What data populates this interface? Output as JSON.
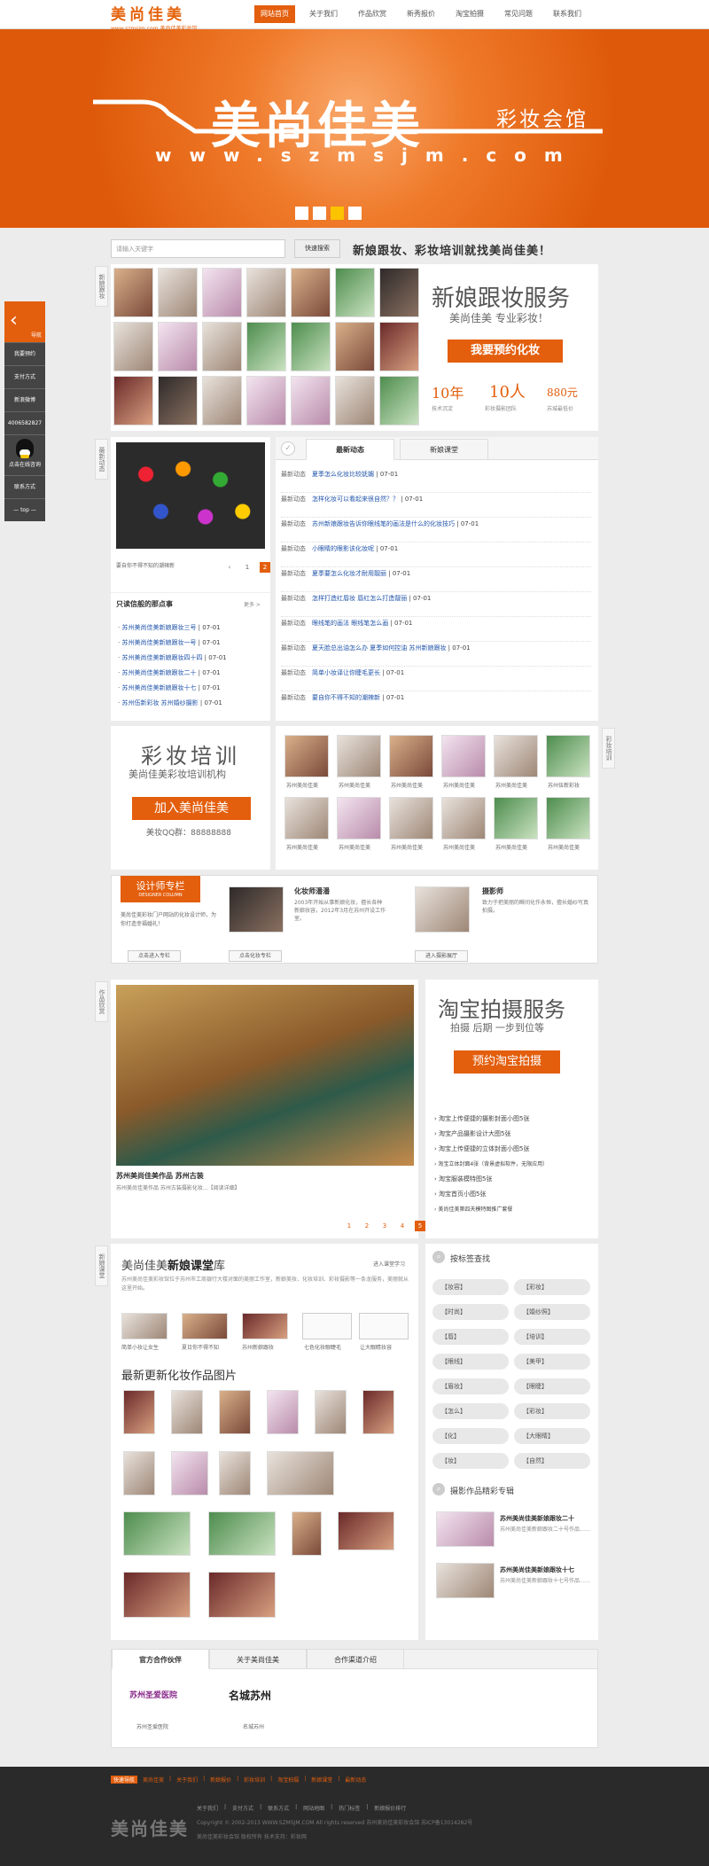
{
  "brand": {
    "name": "美尚佳美",
    "sub": "www.szmsjm.com 美尚佳美彩妆馆"
  },
  "nav": [
    "网站首页",
    "关于我们",
    "作品欣赏",
    "新秀报价",
    "淘宝拍摄",
    "常见问题",
    "联系我们"
  ],
  "banner": {
    "title": "美尚佳美",
    "subtitle": "彩妆会馆",
    "url": "www.szmsjm.com"
  },
  "search": {
    "placeholder": "请输入关键字",
    "button": "快速搜索",
    "slogan": "新娘跟妆、彩妆培训就找美尚佳美！"
  },
  "sidebar": {
    "top": "导航",
    "items": [
      "我要预约",
      "支付方式",
      "新浪微博",
      "4006582827",
      "点击在线咨询",
      "联系方式",
      "— top —"
    ]
  },
  "bride": {
    "tag": "新娘跟妆",
    "title": "新娘跟妆服务",
    "subtitle": "美尚佳美 专业彩妆！",
    "button": "我要预约化妆",
    "stats": [
      {
        "num": "10年",
        "label": "技术沉淀"
      },
      {
        "num": "10人",
        "label": "彩妆摄影团队"
      },
      {
        "num": "880元",
        "label": "苏城最低价"
      }
    ]
  },
  "news": {
    "tag": "最新动态",
    "caption": "要自你不得不知的潮辣新",
    "tabs": [
      "最新动态",
      "新娘课堂"
    ],
    "items": [
      {
        "k": "最新动态",
        "t": "夏季怎么化妆比较妩媚",
        "d": "07-01"
      },
      {
        "k": "最新动态",
        "t": "怎样化妆可以看起来很自然？？",
        "d": "07-01"
      },
      {
        "k": "最新动态",
        "t": "苏州新娘跟妆告诉你眼线笔的画法是什么的化妆技巧",
        "d": "07-01"
      },
      {
        "k": "最新动态",
        "t": "小眼睛的眼影该化妆呢",
        "d": "07-01"
      },
      {
        "k": "最新动态",
        "t": "夏季要怎么化妆才耐用靓丽",
        "d": "07-01"
      },
      {
        "k": "最新动态",
        "t": "怎样打造红唇妆 唇红怎么打造靓丽",
        "d": "07-01"
      },
      {
        "k": "最新动态",
        "t": "眼线笔的画法 眼线笔怎么画",
        "d": "07-01"
      },
      {
        "k": "最新动态",
        "t": "夏天脸总出油怎么办 夏季如何控油 苏州新娘跟妆",
        "d": "07-01"
      },
      {
        "k": "最新动态",
        "t": "简单小妆译让你睫毛更长",
        "d": "07-01"
      },
      {
        "k": "最新动态",
        "t": "要自你不得不知的潮辣新",
        "d": "07-01"
      }
    ],
    "pager": [
      "1",
      "2",
      "3"
    ]
  },
  "works": {
    "title": "只读信般的那点事",
    "more": "更多 >",
    "items": [
      {
        "t": "苏州美尚佳美新娘跟妆三号",
        "d": "07-01"
      },
      {
        "t": "苏州美尚佳美新娘跟妆一号",
        "d": "07-01"
      },
      {
        "t": "苏州美尚佳美新娘跟妆四十四",
        "d": "07-01"
      },
      {
        "t": "苏州美尚佳美新娘跟妆二十",
        "d": "07-01"
      },
      {
        "t": "苏州美尚佳美新娘跟妆十七",
        "d": "07-01"
      },
      {
        "t": "苏州伍新彩妆 苏州婚纱摄影",
        "d": "07-01"
      }
    ]
  },
  "training": {
    "title": "彩妆培训",
    "subtitle": "美尚佳美彩妆培训机构",
    "button": "加入美尚佳美",
    "qq": "美妆QQ群：88888888",
    "tag": "彩妆培训",
    "captions": [
      "苏州美尚佳美",
      "苏州美尚佳美",
      "苏州美尚佳美",
      "苏州美尚佳美",
      "苏州美尚佳美",
      "苏州伍新彩妆",
      "苏州美尚佳美",
      "苏州美尚佳美",
      "苏州美尚佳美",
      "苏州美尚佳美",
      "苏州美尚佳美",
      "苏州美尚佳美"
    ]
  },
  "designer": {
    "badge": "设计师专栏",
    "badge_en": "DESIGNER COLUMN",
    "intro": "美尚佳美彩妆门户网站的化妆设计师，为你打造幸福婚礼！",
    "enter": "点击进入专栏",
    "cols": [
      {
        "title": "化妆师潘潘",
        "text": "2003年开始从事新娘化妆，擅长各种新娘妆容，2012年3月在苏州开设工作室。",
        "btn": "点击化妆专栏"
      },
      {
        "title": "摄影师",
        "text": "致力于把美丽的瞬间化作永恒，擅长婚纱写真拍摄。",
        "btn": "进入摄影展厅"
      }
    ]
  },
  "album": {
    "tag": "作品欣赏",
    "title": "苏州美尚佳美作品 苏州古装",
    "desc": "苏州美尚佳美作品 苏州古装摄影化妆...【阅读详细】",
    "pager": [
      "1",
      "2",
      "3",
      "4",
      "5"
    ]
  },
  "taobao": {
    "title": "淘宝拍摄服务",
    "subtitle": "拍摄 后期 一步到位等",
    "button": "预约淘宝拍摄",
    "items": [
      "淘宝上传便捷的摄影封面小图5张",
      "淘宝产品摄影设计大图5张",
      "淘宝上传便捷的立体封面小图5张",
      "淘宝立体封面4张（背景虚拟软件，无限应用）",
      "淘宝服装模特图5张",
      "淘宝首页小图5张",
      "美尚佳美第四天模特图推广套餐"
    ]
  },
  "classroom": {
    "tag": "新娘课堂",
    "title_prefix": "美尚佳美",
    "title_hl": "新娘课堂",
    "title_suffix": "库",
    "enter": "进入课堂学习",
    "desc": "苏州美尚佳美彩妆馆位于苏州市工商银行大楼对面的美丽工作室，新娘美妆、化妆培训、彩妆摄影等一条龙服务，美丽就从这里开始。",
    "thumbs": [
      "简单小妆让女生",
      "夏日你不得不知",
      "苏州新娘跟妆",
      "七色化妆眼睫毛",
      "让大眼睛妆容"
    ],
    "latest": "最新更新化妆作品图片"
  },
  "tags": {
    "title": "按标签查找",
    "pills": [
      "【妆容】",
      "【彩妆】",
      "【时尚】",
      "【婚纱照】",
      "【唇】",
      "【培训】",
      "【眼线】",
      "【美甲】",
      "【眉妆】",
      "【眼睫】",
      "【怎么】",
      "【彩妆】",
      "【化】",
      "【大眼睛】",
      "【妆】",
      "【自然】"
    ]
  },
  "special": {
    "title": "摄影作品精彩专辑",
    "items": [
      {
        "t": "苏州美尚佳美新娘跟妆二十",
        "d": "苏州美尚佳美新娘跟妆二十号作品……"
      },
      {
        "t": "苏州美尚佳美新娘跟妆十七",
        "d": "苏州美尚佳美新娘跟妆十七号作品……"
      }
    ]
  },
  "partners": {
    "tabs": [
      "官方合作伙伴",
      "关于美尚佳美",
      "合作渠道介绍"
    ],
    "items": [
      {
        "logo": "苏州圣爱医院",
        "name": "苏州圣爱医院"
      },
      {
        "logo": "名城苏州",
        "name": "名城苏州"
      }
    ]
  },
  "footer": {
    "hd": "快速导航",
    "links": [
      "美尚佳美",
      "关于我们",
      "新娘报价",
      "彩妆培训",
      "淘宝拍摄",
      "新娘课堂",
      "最新动态"
    ],
    "links2": [
      "关于我们",
      "支付方式",
      "联系方式",
      "网站地图",
      "热门标签",
      "新娘报价排行"
    ],
    "logo": "美尚佳美",
    "copy": "Copyright © 2002-2013 WWW.SZMSJM.COM All rights reserved 苏州美尚佳美彩妆会馆 苏ICP备13014282号",
    "copy2": "美尚佳美彩妆会馆 版权所有  技术支持：彩妆网"
  }
}
